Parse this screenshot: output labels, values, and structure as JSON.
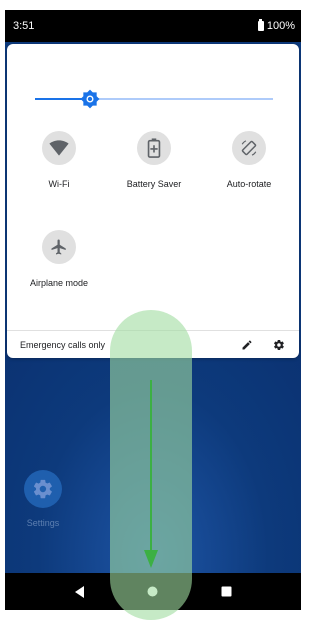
{
  "status_bar": {
    "time": "3:51",
    "battery": "100%"
  },
  "quick_settings": {
    "brightness_level": 0.23,
    "tiles": [
      {
        "label": "Wi-Fi",
        "icon": "wifi-icon"
      },
      {
        "label": "Battery Saver",
        "icon": "battery-saver-icon"
      },
      {
        "label": "Auto-rotate",
        "icon": "auto-rotate-icon"
      },
      {
        "label": "Airplane mode",
        "icon": "airplane-icon"
      }
    ],
    "footer": {
      "text": "Emergency calls only",
      "edit_icon": "edit-icon",
      "settings_icon": "gear-icon"
    }
  },
  "home": {
    "apps": [
      {
        "label": "Settings",
        "icon": "gear-icon"
      }
    ]
  },
  "nav_bar": {
    "back_icon": "back-icon",
    "home_icon": "home-icon",
    "recents_icon": "recents-icon"
  },
  "colors": {
    "accent": "#1a73e8",
    "wallpaper": "#0d3a7c",
    "swipe_overlay": "#a0dca0",
    "swipe_arrow": "#3cb043"
  }
}
